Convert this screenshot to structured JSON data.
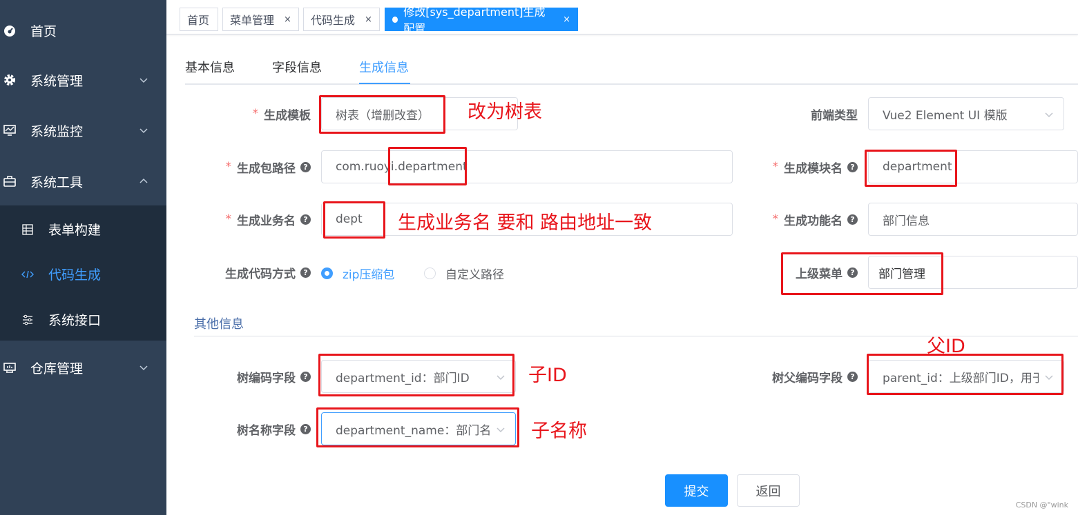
{
  "sidebar": {
    "items": [
      {
        "label": "首页",
        "icon": "dashboard-icon"
      },
      {
        "label": "系统管理",
        "icon": "gear-icon"
      },
      {
        "label": "系统监控",
        "icon": "monitor-icon"
      },
      {
        "label": "系统工具",
        "icon": "toolbox-icon"
      },
      {
        "label": "仓库管理",
        "icon": "warehouse-icon"
      }
    ],
    "sub_items": [
      {
        "label": "表单构建",
        "icon": "table-icon"
      },
      {
        "label": "代码生成",
        "icon": "code-icon"
      },
      {
        "label": "系统接口",
        "icon": "sliders-icon"
      }
    ]
  },
  "tags": [
    {
      "label": "首页"
    },
    {
      "label": "菜单管理",
      "close": "×"
    },
    {
      "label": "代码生成",
      "close": "×"
    },
    {
      "label": "修改[sys_department]生成配置",
      "close": "×"
    }
  ],
  "tabs": [
    "基本信息",
    "字段信息",
    "生成信息"
  ],
  "form": {
    "required_mark": "*",
    "help_mark": "?",
    "tpl_label": "生成模板",
    "tpl_value": "树表（增删改查）",
    "frontend_label": "前端类型",
    "frontend_value": "Vue2 Element UI 模版",
    "package_label": "生成包路径",
    "package_value": "com.ruoyi.department",
    "module_label": "生成模块名",
    "module_value": "department",
    "business_label": "生成业务名",
    "business_value": "dept",
    "function_label": "生成功能名",
    "function_value": "部门信息",
    "gentype_label": "生成代码方式",
    "gentype_options": [
      "zip压缩包",
      "自定义路径"
    ],
    "parent_menu_label": "上级菜单",
    "parent_menu_value": "部门管理",
    "other_title": "其他信息",
    "tree_code_label": "树编码字段",
    "tree_code_value": "department_id：部门ID",
    "tree_parent_label": "树父编码字段",
    "tree_parent_value": "parent_id：上级部门ID，用于",
    "tree_name_label": "树名称字段",
    "tree_name_value": "department_name：部门名称"
  },
  "buttons": {
    "submit": "提交",
    "back": "返回"
  },
  "annotations": {
    "tpl": "改为树表",
    "business": "生成业务名 要和 路由地址一致",
    "child_id": "子ID",
    "parent_id": "父ID",
    "child_name": "子名称"
  },
  "watermark": "CSDN @\"wink",
  "colors": {
    "sidebar": "#304156",
    "submenu": "#1f2d3d",
    "primary": "#1890ff",
    "annotation": "#e8151b"
  }
}
